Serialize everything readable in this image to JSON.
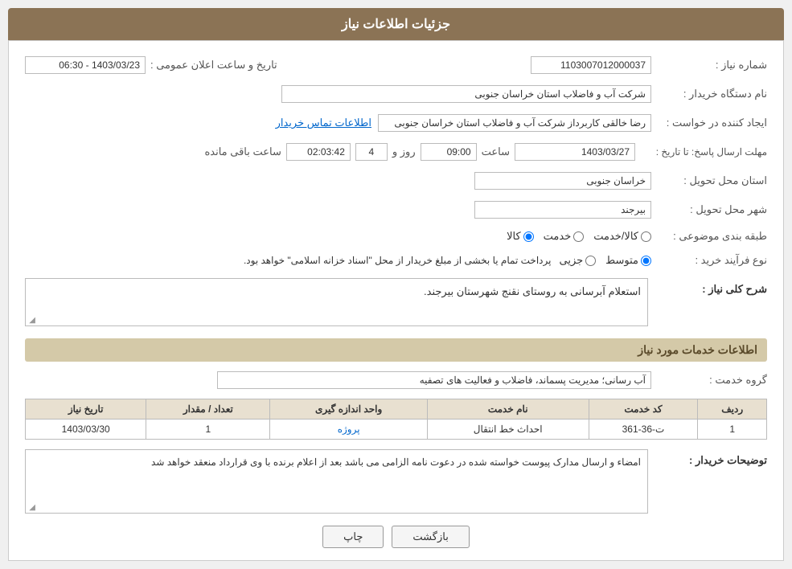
{
  "header": {
    "title": "جزئیات اطلاعات نیاز"
  },
  "fields": {
    "shomare_niaz_label": "شماره نیاز :",
    "shomare_niaz_value": "1103007012000037",
    "nam_dastgah_label": "نام دستگاه خریدار :",
    "nam_dastgah_value": "شرکت آب و فاضلاب استان خراسان جنوبی",
    "ijad_konande_label": "ایجاد کننده در خواست :",
    "ijad_konande_value": "رضا خالقی کاربرداز شرکت آب و فاضلاب استان خراسان جنوبی",
    "ettelaat_tamas_label": "اطلاعات تماس خریدار",
    "mohlat_label": "مهلت ارسال پاسخ: تا تاریخ :",
    "mohlat_date": "1403/03/27",
    "mohlat_time_label": "ساعت",
    "mohlat_time": "09:00",
    "mohlat_roz_label": "روز و",
    "mohlat_roz_value": "4",
    "mohlat_saet_label": "ساعت باقی مانده",
    "mohlat_remaining": "02:03:42",
    "tarikh_label": "تاریخ و ساعت اعلان عمومی :",
    "tarikh_value": "1403/03/23 - 06:30",
    "ostan_tahvil_label": "استان محل تحویل :",
    "ostan_tahvil_value": "خراسان جنوبی",
    "shahr_tahvil_label": "شهر محل تحویل :",
    "shahr_tahvil_value": "بیرجند",
    "tabaqe_label": "طبقه بندی موضوعی :",
    "tabaqe_options": [
      "کالا",
      "خدمت",
      "کالا/خدمت"
    ],
    "tabaqe_selected": "کالا",
    "noee_farayand_label": "نوع فرآیند خرید :",
    "noee_farayand_options": [
      "جزیی",
      "متوسط"
    ],
    "noee_farayand_selected": "متوسط",
    "noee_farayand_text": "پرداخت تمام یا بخشی از مبلغ خریدار از محل \"اسناد خزانه اسلامی\" خواهد بود.",
    "sharh_label": "شرح کلی نیاز :",
    "sharh_value": "استعلام آبرسانی به روستای نقنج شهرستان بیرجند.",
    "services_section_label": "اطلاعات خدمات مورد نیاز",
    "grooh_khadmat_label": "گروه خدمت :",
    "grooh_khadmat_value": "آب رسانی؛ مدیریت پسماند، فاضلاب و فعالیت های تصفیه",
    "table_headers": [
      "ردیف",
      "کد خدمت",
      "نام خدمت",
      "واحد اندازه گیری",
      "تعداد / مقدار",
      "تاریخ نیاز"
    ],
    "table_rows": [
      {
        "radif": "1",
        "code": "ت-36-361",
        "name": "احداث خط انتقال",
        "unit": "پروژه",
        "count": "1",
        "date": "1403/03/30"
      }
    ],
    "tawzih_label": "توضیحات خریدار :",
    "tawzih_value": "امضاء و ارسال مدارک پیوست خواسته شده در دعوت نامه الزامی می باشد بعد از اعلام برنده با وی قرارداد منعقد خواهد شد"
  },
  "buttons": {
    "back_label": "بازگشت",
    "print_label": "چاپ"
  }
}
